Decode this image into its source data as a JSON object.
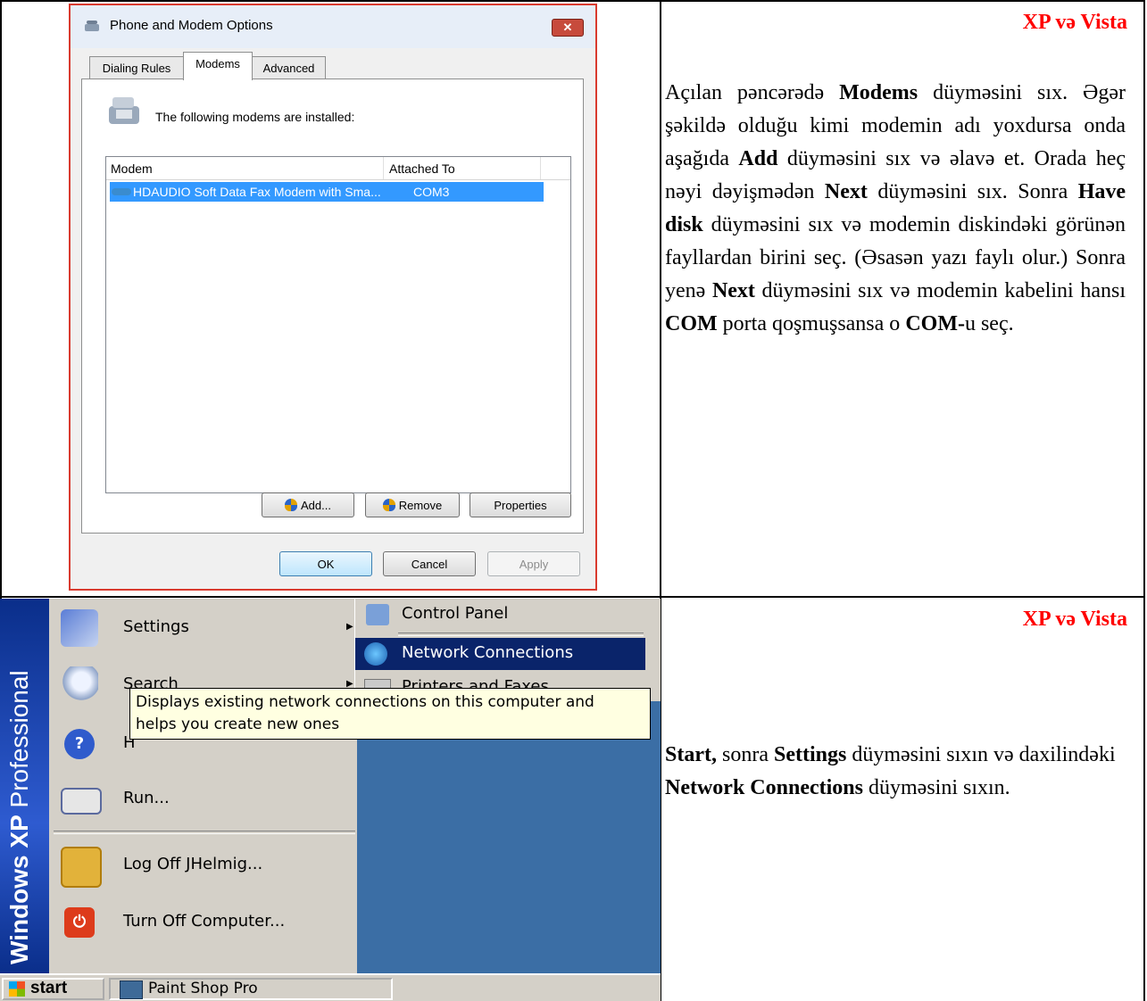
{
  "top_row": {
    "badge": "XP və Vista",
    "paragraph_html": "Açılan pəncərədə <b>Modems</b> düyməsini sıx. Əgər şəkildə olduğu kimi modemin adı yoxdursa onda aşağıda <b>Add</b> düyməsini sıx və əlavə et. Orada heç nəyi dəyişmədən <b>Next</b> düyməsini sıx. Sonra <b>Have disk</b> düyməsini sıx və modemin diskindəki görünən fayllardan birini seç. (Əsasən yazı faylı olur.) Sonra yenə <b>Next</b> düyməsini sıx və modemin kabelini hansı <b>COM</b> porta qoşmuşsansa o <b>COM-</b>u seç.",
    "dialog": {
      "title": "Phone and Modem Options",
      "close": "✕",
      "tabs": [
        "Dialing Rules",
        "Modems",
        "Advanced"
      ],
      "header_text": "The following modems are installed:",
      "columns": [
        "Modem",
        "Attached To"
      ],
      "row": {
        "modem": "HDAUDIO Soft Data Fax Modem with Sma...",
        "port": "COM3"
      },
      "buttons": {
        "add": "Add...",
        "remove": "Remove",
        "properties": "Properties",
        "ok": "OK",
        "cancel": "Cancel",
        "apply": "Apply"
      }
    }
  },
  "bottom_row": {
    "badge": "XP və Vista",
    "paragraph_html": "<b>Start,</b> sonra  <b>Settings</b>  düyməsini sıxın və daxilindəki <b>Network Connections</b> düyməsini sıxın.",
    "xp": {
      "side_banner_bold": "Windows XP",
      "side_banner_rest": " Professional",
      "menu": [
        "Settings",
        "Search",
        "H",
        "Run...",
        "Log Off JHelmig...",
        "Turn Off Computer..."
      ],
      "submenu": [
        "Control Panel",
        "Network Connections",
        "Printers and Faxes"
      ],
      "tooltip_line1": "Displays existing network connections on this computer and",
      "tooltip_line2": "helps you create new ones",
      "start": "start",
      "task": "Paint Shop Pro"
    }
  }
}
